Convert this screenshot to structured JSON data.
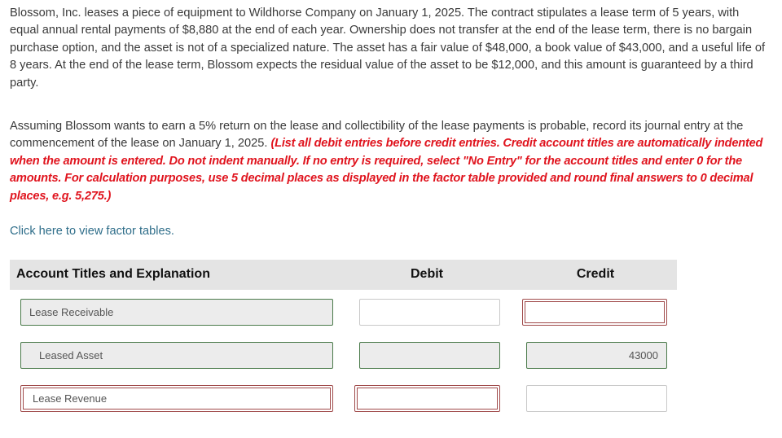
{
  "question": {
    "paragraph1": "Blossom, Inc. leases a piece of equipment to Wildhorse Company on January 1, 2025. The contract stipulates a lease term of 5 years, with equal annual rental payments of $8,880 at the end of each year. Ownership does not transfer at the end of the lease term, there is no bargain purchase option, and the asset is not of a specialized nature. The asset has a fair value of $48,000, a book value of $43,000, and a useful life of 8 years. At the end of the lease term, Blossom expects the residual value of the asset to be $12,000, and this amount is guaranteed by a third party.",
    "paragraph2_plain": "Assuming Blossom wants to earn a 5% return on the lease and collectibility of the lease payments is probable, record its journal entry at the commencement of the lease on January 1, 2025. ",
    "paragraph2_instructions": "(List all debit entries before credit entries. Credit account titles are automatically indented when the amount is entered. Do not indent manually. If no entry is required, select \"No Entry\" for the account titles and enter 0 for the amounts. For calculation purposes, use 5 decimal places as displayed in the factor table provided and round final answers to 0 decimal places, e.g. 5,275.)",
    "factor_link": "Click here to view factor tables."
  },
  "table": {
    "headers": {
      "account": "Account Titles and Explanation",
      "debit": "Debit",
      "credit": "Credit"
    },
    "rows": [
      {
        "account": "Lease Receivable",
        "debit": "",
        "credit": "",
        "account_status": "correct",
        "debit_status": "blank",
        "credit_status": "incorrect"
      },
      {
        "account": "Leased Asset",
        "debit": "",
        "credit": "43000",
        "account_status": "correct",
        "debit_status": "correct",
        "credit_status": "correct"
      },
      {
        "account": "Lease Revenue",
        "debit": "",
        "credit": "",
        "account_status": "incorrect",
        "debit_status": "incorrect",
        "credit_status": "blank"
      }
    ]
  },
  "colors": {
    "instruction_red": "#e0141e",
    "link": "#2f6e8a",
    "correct_border": "#4a7a4a",
    "incorrect_border": "#a04a4a"
  }
}
